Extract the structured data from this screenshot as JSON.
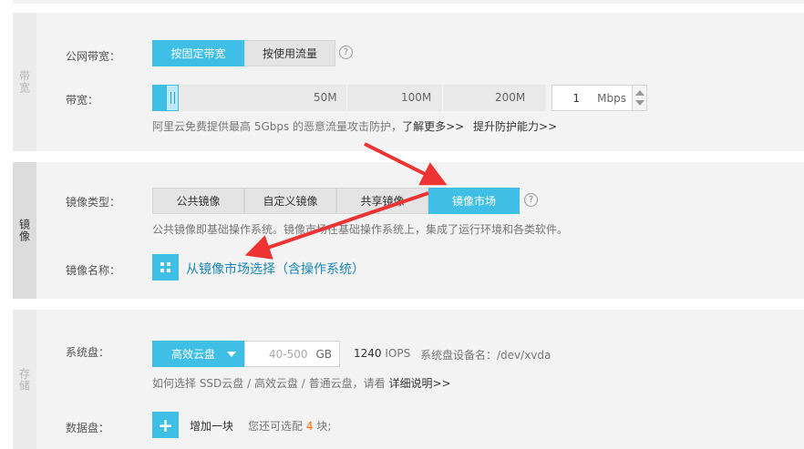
{
  "bandwidth_section": {
    "side_label": "带宽",
    "billing_label": "公网带宽：",
    "billing_options": [
      "按固定带宽",
      "按使用流量"
    ],
    "billing_selected": 0,
    "bandwidth_label": "带宽：",
    "slider": {
      "ticks": [
        "50M",
        "100M",
        "200M"
      ],
      "value_fraction": 0.05
    },
    "bandwidth_value": "1",
    "bandwidth_unit": "Mbps",
    "protection_note": "阿里云免费提供最高 5Gbps 的恶意流量攻击防护，",
    "learn_more": "了解更多>>",
    "upgrade_link": "提升防护能力>>"
  },
  "image_section": {
    "side_label": "镜像",
    "type_label": "镜像类型：",
    "type_options": [
      "公共镜像",
      "自定义镜像",
      "共享镜像",
      "镜像市场"
    ],
    "type_selected": 3,
    "type_note": "公共镜像即基础操作系统。镜像市场在基础操作系统上，集成了运行环境和各类软件。",
    "name_label": "镜像名称：",
    "choose_link": "从镜像市场选择（含操作系统）"
  },
  "storage_section": {
    "side_label": "存储",
    "system_disk_label": "系统盘：",
    "disk_type": "高效云盘",
    "size_placeholder": "40-500",
    "size_unit": "GB",
    "iops_value": "1240",
    "iops_unit": "IOPS",
    "device_name": "系统盘设备名：/dev/xvda",
    "choose_note": "如何选择 SSD云盘 / 高效云盘 / 普通云盘，请看",
    "details_link": "详细说明>>",
    "data_disk_label": "数据盘：",
    "add_label": "增加一块",
    "remaining_prefix": "您还可选配",
    "remaining_count": "4",
    "remaining_suffix": "块;"
  },
  "colors": {
    "accent": "#3fbfe6",
    "annotation_arrow": "#ee3333",
    "link": "#1a87b6"
  },
  "icons": [
    "help-icon",
    "grid-icon",
    "plus-icon",
    "caret-down-icon",
    "slider-handle-icon"
  ]
}
